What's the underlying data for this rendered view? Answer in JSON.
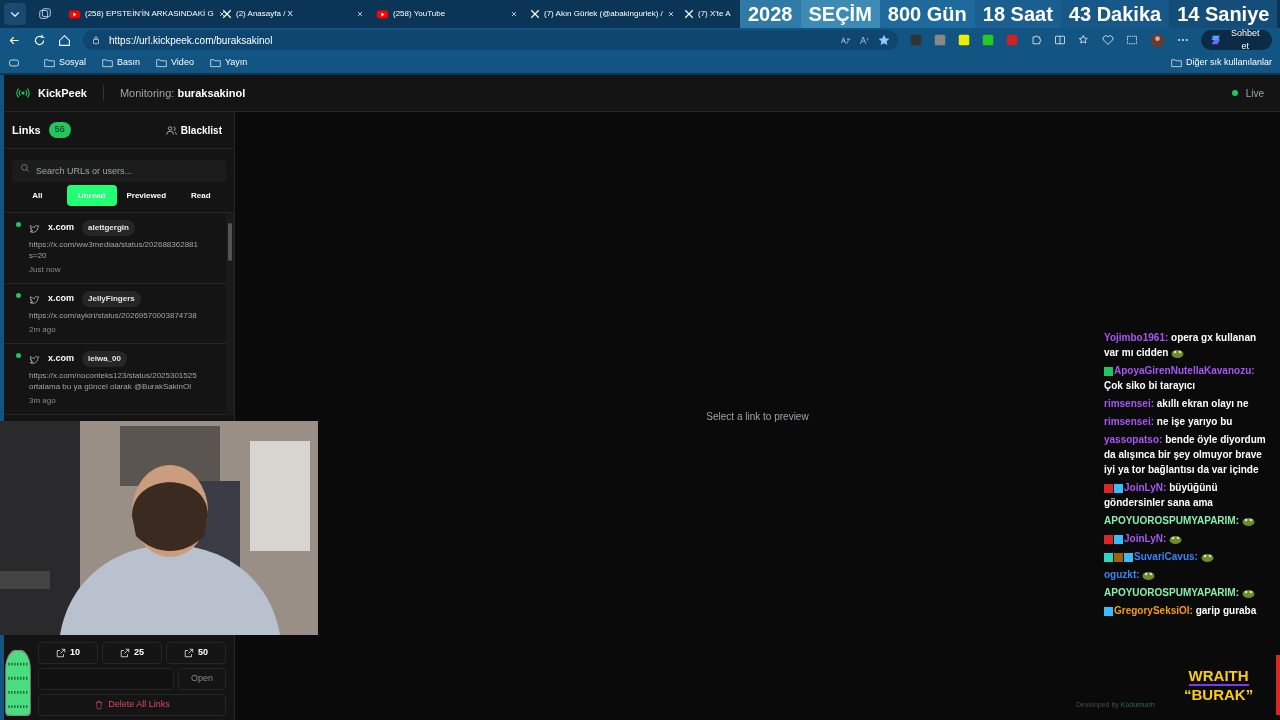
{
  "browser": {
    "tabs": [
      {
        "title": "(258) EPSTEİN'İN ARKASINDAKİ G",
        "kind": "youtube",
        "selected": false
      },
      {
        "title": "(2) Anasayfa / X",
        "kind": "x",
        "selected": false
      },
      {
        "title": "(258) YouTube",
        "kind": "youtube",
        "selected": false
      },
      {
        "title": "(7) Akın Gürlek (@abakingurlek) /",
        "kind": "x",
        "selected": false
      },
      {
        "title": "(7) X'te A",
        "kind": "x",
        "selected": false
      }
    ],
    "url": "https://url.kickpeek.com/buraksakinol",
    "copilot_label": "Sohbet et",
    "bookmarks": [
      "Sosyal",
      "Basın",
      "Video",
      "Yayın"
    ],
    "other_bookmarks": "Diğer sık kullanılanlar"
  },
  "countdown": [
    "2028",
    "SEÇİM",
    "800 Gün",
    "18 Saat",
    "43 Dakika",
    "14 Saniye"
  ],
  "app": {
    "name": "KickPeek",
    "monitoring_label": "Monitoring:",
    "monitoring_user": "buraksakinol",
    "status": "Live",
    "live": true
  },
  "sidebar": {
    "title": "Links",
    "count": "56",
    "blacklist": "Blacklist",
    "search": {
      "placeholder": "Search URLs or users..."
    },
    "filters": [
      {
        "label": "All",
        "selected": false
      },
      {
        "label": "Unread",
        "selected": true
      },
      {
        "label": "Previewed",
        "selected": false
      },
      {
        "label": "Read",
        "selected": false
      }
    ],
    "links": [
      {
        "site": "x.com",
        "user": "alettgergin",
        "url": "https://x.com/ww3mediaa/status/202688362881 s=20",
        "time": "Just now",
        "unread": true
      },
      {
        "site": "x.com",
        "user": "JellyFingers",
        "url": "https://x.com/aykiri/status/20269570003874738",
        "time": "2m ago",
        "unread": true
      },
      {
        "site": "x.com",
        "user": "leiwa_00",
        "url": "https://x.com/noconteks123/status/2025301525 ortalama bu ya güncel olarak @BurakSakinOl",
        "time": "3m ago",
        "unread": true
      }
    ],
    "open_counts": [
      "10",
      "25",
      "50"
    ],
    "open_button": "Open",
    "delete_button": "Delete All Links"
  },
  "preview": {
    "empty_text": "Select a link to preview"
  },
  "chat": [
    {
      "user": "Yojimbo1961:",
      "color": "#a855f7",
      "text": "opera gx kullanan var mı cidden",
      "emote": true
    },
    {
      "user": "ApoyaGirenNutellaKavanozu:",
      "color": "#a855f7",
      "text": "Çok siko bi tarayıcı",
      "badges": [
        {
          "color": "#22c55e"
        }
      ]
    },
    {
      "user": "rimsensei:",
      "color": "#a855f7",
      "text": "akıllı ekran olayı ne"
    },
    {
      "user": "rimsensei:",
      "color": "#a855f7",
      "text": "ne işe yarıyo bu"
    },
    {
      "user": "yassopatso:",
      "color": "#a855f7",
      "text": "bende öyle diyordum da alışınca bir şey olmuyor brave iyi ya tor bağlantısı da var içinde"
    },
    {
      "user": "JoinLyN:",
      "color": "#a855f7",
      "text": "büyüğünü göndersinler sana ama",
      "badges": [
        {
          "color": "#dc2626"
        },
        {
          "color": "#38bdf8"
        }
      ]
    },
    {
      "user": "APOYUOROSPUMYAPARIM:",
      "color": "#86efac",
      "emote": true
    },
    {
      "user": "JoinLyN:",
      "color": "#a855f7",
      "badges": [
        {
          "color": "#dc2626"
        },
        {
          "color": "#38bdf8"
        }
      ],
      "emote": true
    },
    {
      "user": "SuvariCavus:",
      "color": "#3b82f6",
      "badges": [
        {
          "color": "#2dd4bf"
        },
        {
          "color": "#a16207"
        },
        {
          "color": "#38bdf8"
        }
      ],
      "emote": true
    },
    {
      "user": "oguzkt:",
      "color": "#3b82f6",
      "emote": true
    },
    {
      "user": "APOYUOROSPUMYAPARIM:",
      "color": "#86efac",
      "emote": true
    },
    {
      "user": "GregorySeksiOl:",
      "color": "#f59e0b",
      "text": "garip guraba",
      "badges": [
        {
          "color": "#38bdf8"
        }
      ]
    }
  ],
  "overlay": {
    "developed_by": "Developed by",
    "developer": "Kodumunh",
    "logo_top": "WRAITH",
    "logo_bottom": "“BURAK”"
  }
}
